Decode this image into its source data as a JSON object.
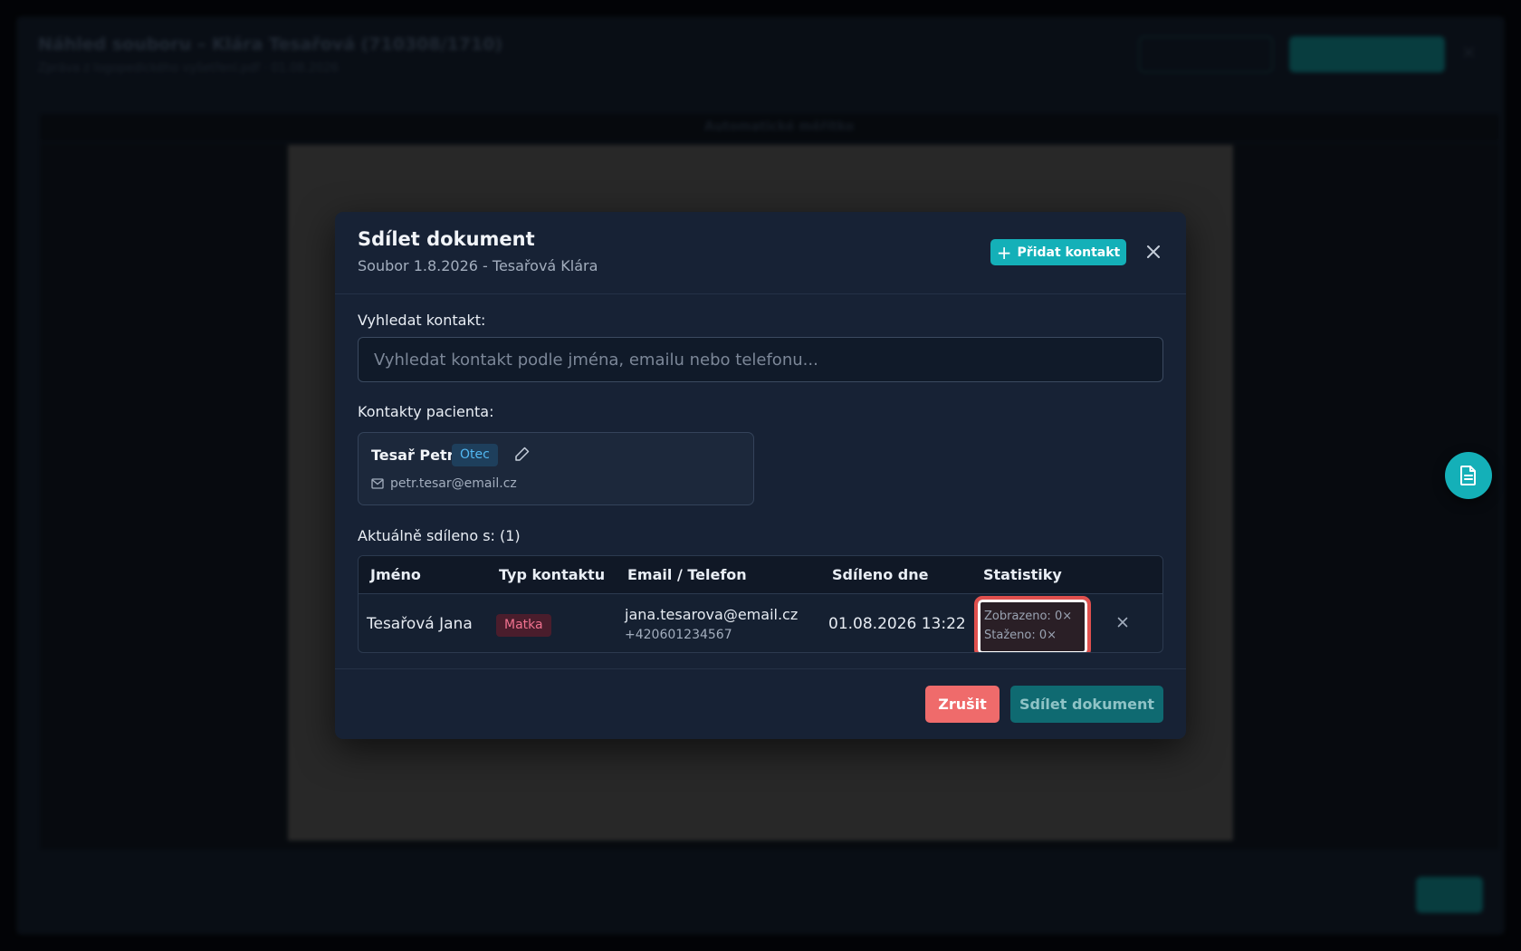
{
  "background": {
    "title": "Náhled souboru – Klára Tesařová (710308/1710)",
    "subtitle": "Zpráva z logopedického vyšetření.pdf · 01.08.2026",
    "toolbar_text": "Automatické měřítko"
  },
  "modal": {
    "title": "Sdílet dokument",
    "subtitle": "Soubor 1.8.2026 - Tesařová Klára",
    "add_contact_label": "Přidat kontakt",
    "search_label": "Vyhledat kontakt:",
    "search_placeholder": "Vyhledat kontakt podle jména, emailu nebo telefonu...",
    "contacts_label": "Kontakty pacienta:",
    "contacts": [
      {
        "name": "Tesař Petr",
        "relation": "Otec",
        "email": "petr.tesar@email.cz"
      }
    ],
    "shared_label": "Aktuálně sdíleno s: (1)",
    "table": {
      "headers": [
        "Jméno",
        "Typ kontaktu",
        "Email / Telefon",
        "Sdíleno dne",
        "Statistiky"
      ],
      "rows": [
        {
          "name": "Tesařová Jana",
          "type": "Matka",
          "email": "jana.tesarova@email.cz",
          "phone": "+420601234567",
          "shared_on": "01.08.2026 13:22",
          "viewed": "Zobrazeno: 0×",
          "downloaded": "Staženo: 0×"
        }
      ]
    },
    "cancel_label": "Zrušit",
    "share_label": "Sdílet dokument"
  },
  "colors": {
    "accent": "#14b0b8",
    "danger": "#ef6b6b",
    "highlight_outline": "#e0504e",
    "modal_bg": "#172235"
  },
  "icons": [
    "plus-icon",
    "close-icon",
    "edit-icon",
    "mail-icon",
    "remove-icon",
    "document-icon"
  ]
}
